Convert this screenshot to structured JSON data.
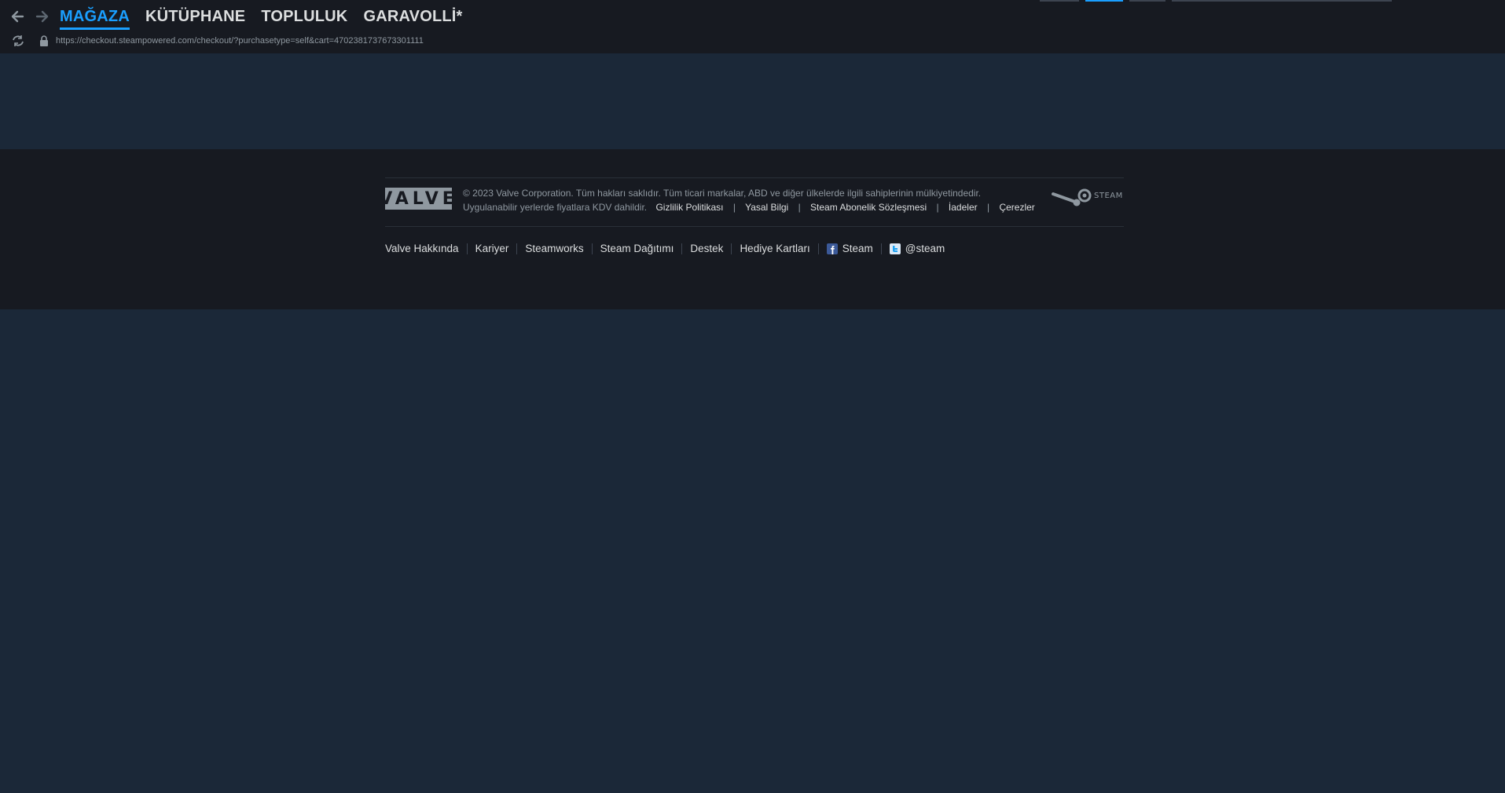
{
  "nav": {
    "items": [
      {
        "label": "MAĞAZA",
        "active": true
      },
      {
        "label": "KÜTÜPHANE",
        "active": false
      },
      {
        "label": "TOPLULUK",
        "active": false
      },
      {
        "label": "GARAVOLLİ*",
        "active": false
      }
    ]
  },
  "urlbar": {
    "url": "https://checkout.steampowered.com/checkout/?purchasetype=self&cart=4702381737673301111"
  },
  "footer": {
    "valve_logo_text": "VALVE",
    "copyright": "© 2023 Valve Corporation. Tüm hakları saklıdır. Tüm ticari markalar, ABD ve diğer ülkelerde ilgili sahiplerinin mülkiyetindedir.",
    "vat_note": "Uygulanabilir yerlerde fiyatlara KDV dahildir.",
    "legal_links": [
      "Gizlilik Politikası",
      "Yasal Bilgi",
      "Steam Abonelik Sözleşmesi",
      "İadeler",
      "Çerezler"
    ],
    "steam_logo_text": "STEAM",
    "links": [
      "Valve Hakkında",
      "Kariyer",
      "Steamworks",
      "Steam Dağıtımı",
      "Destek",
      "Hediye Kartları"
    ],
    "facebook_label": "Steam",
    "twitter_label": "@steam"
  },
  "colors": {
    "background": "#1b2838",
    "bar": "#171a21",
    "accent": "#1a9fff",
    "text": "#dcdedf",
    "muted": "#8f98a0"
  },
  "icons": [
    "back-arrow-icon",
    "forward-arrow-icon",
    "reload-icon",
    "lock-icon",
    "facebook-icon",
    "twitter-icon"
  ]
}
